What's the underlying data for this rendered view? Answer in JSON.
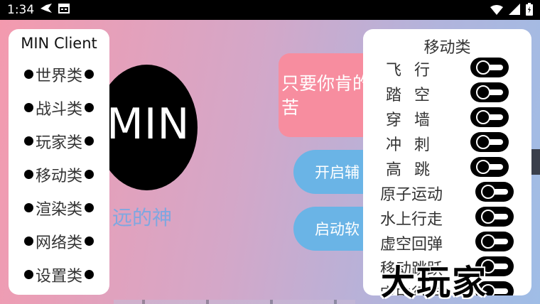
{
  "status_bar": {
    "time": "1:34",
    "icons": [
      "bird-app-icon",
      "calendar-icon",
      "wifi-icon",
      "signal-icon",
      "battery-icon"
    ]
  },
  "left_menu": {
    "title": "MIN Client",
    "items": [
      "世界类",
      "战斗类",
      "玩家类",
      "移动类",
      "渲染类",
      "网络类",
      "设置类"
    ]
  },
  "logo": {
    "text": "MIN"
  },
  "subtitle": "远的神",
  "promo_card": {
    "text": "只要你肯的苦"
  },
  "buttons": {
    "open_aux": "开启辅",
    "start_app": "启动软"
  },
  "movement_panel": {
    "title": "移动类",
    "items": [
      {
        "label": "飞行",
        "on": true
      },
      {
        "label": "踏空",
        "on": true
      },
      {
        "label": "穿墙",
        "on": true
      },
      {
        "label": "冲刺",
        "on": true
      },
      {
        "label": "高跳",
        "on": true
      },
      {
        "label": "原子运动",
        "on": true
      },
      {
        "label": "水上行走",
        "on": true
      },
      {
        "label": "虚空回弹",
        "on": true
      },
      {
        "label": "移动跳跃",
        "on": true
      },
      {
        "label": "空中行走",
        "on": true
      }
    ]
  },
  "watermark": "大玩家",
  "colors": {
    "pink_card": "#f78d9f",
    "blue_button": "#6ab4e6",
    "subtitle": "#7fa7e0"
  }
}
